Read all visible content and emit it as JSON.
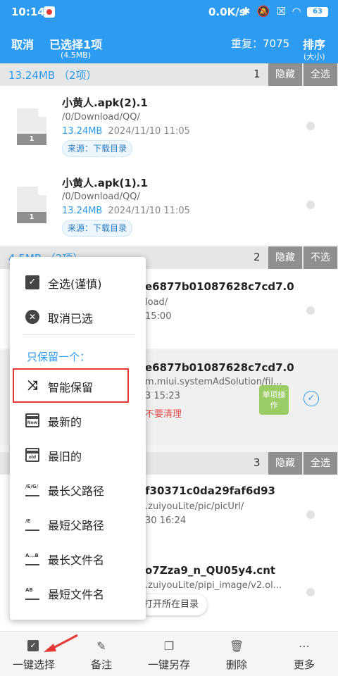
{
  "status_bar": {
    "time": "10:14",
    "net_speed": "0.0K/s",
    "icons": [
      "bluetooth-icon",
      "mute-icon",
      "sim-icon",
      "wifi-icon"
    ],
    "icons_glyphs": "✱ 🔕 ☒ ◠",
    "battery": "63"
  },
  "action_bar": {
    "cancel": "取消",
    "selected": "已选择1项",
    "selected_size": "(4.5MB)",
    "duplicates": "重复：7075",
    "sort": "排序",
    "sort_sub": "(大小)"
  },
  "groups": [
    {
      "size": "13.24MB  （2项）",
      "number": "1",
      "hide": "隐藏",
      "select": "全选",
      "files": [
        {
          "name": "小黄人.apk(2).1",
          "path": "/0/Download/QQ/",
          "size": "13.24MB",
          "date": "2024/11/10 11:05",
          "source": "来源：下载目录",
          "icon_label": "1"
        },
        {
          "name": "小黄人.apk(1).1",
          "path": "/0/Download/QQ/",
          "size": "13.24MB",
          "date": "2024/11/10 11:05",
          "source": "来源：下载目录",
          "icon_label": "1"
        }
      ]
    },
    {
      "size": "4.5MB  （2项）",
      "number": "2",
      "hide": "隐藏",
      "select": "不选",
      "files": [
        {
          "name": "e6877b01087628c7cd7.0",
          "path": "load/",
          "date": "15:00"
        },
        {
          "name": "e6877b01087628c7cd7.0",
          "path": "m.miui.systemAdSolution/fil...",
          "date": "3 15:23",
          "warning": "不要清理",
          "single": "单项操作"
        }
      ]
    },
    {
      "number": "3",
      "hide": "隐藏",
      "select": "全选",
      "files": [
        {
          "name": "f30371c0da29faf6d93",
          "path": ".zuiyouLite/pic/picUrl/",
          "date": "30 16:24"
        },
        {
          "name": "o7Zza9_n_QU05y4.cnt",
          "path": ".zuiyouLite/pipi_image/v2.ol..."
        }
      ]
    }
  ],
  "open_dir": "打开所在目录",
  "popup_menu": {
    "select_all_careful": "全选(谨慎)",
    "deselect": "取消已选",
    "keep_one_title": "只保留一个：",
    "keep_options": [
      {
        "label": "智能保留",
        "icon": "shuffle-icon"
      },
      {
        "label": "最新的",
        "icon": "calendar-new-icon",
        "icon_text": "New"
      },
      {
        "label": "最旧的",
        "icon": "calendar-old-icon",
        "icon_text": "old"
      },
      {
        "label": "最长父路径",
        "icon": "long-path-icon",
        "icon_text": "/E/G/"
      },
      {
        "label": "最短父路径",
        "icon": "short-path-icon",
        "icon_text": "/E"
      },
      {
        "label": "最长文件名",
        "icon": "long-name-icon",
        "icon_text": "A...B"
      },
      {
        "label": "最短文件名",
        "icon": "short-name-icon",
        "icon_text": "AB"
      }
    ]
  },
  "bottom_bar": [
    {
      "label": "一键选择",
      "icon": "checkbox-icon"
    },
    {
      "label": "备注",
      "icon": "edit-icon"
    },
    {
      "label": "一键另存",
      "icon": "copy-icon"
    },
    {
      "label": "删除",
      "icon": "trash-icon"
    },
    {
      "label": "更多",
      "icon": "more-icon"
    }
  ],
  "colors": {
    "accent": "#2d9cf0",
    "highlight": "#e53935",
    "single_op": "#9ccc65"
  }
}
